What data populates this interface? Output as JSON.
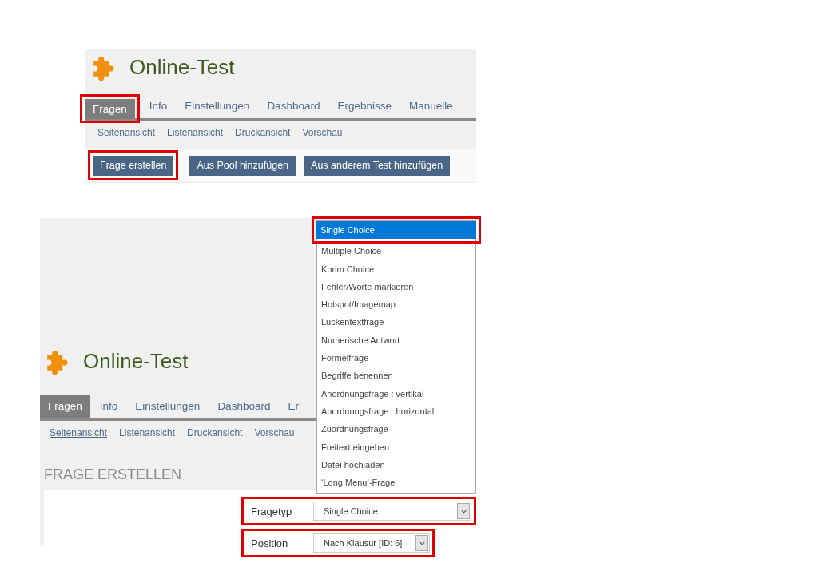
{
  "panels": [
    {
      "title": "Online-Test",
      "tabs": [
        {
          "label": "Fragen",
          "selected": true,
          "highlighted": true
        },
        {
          "label": "Info",
          "selected": false,
          "highlighted": false
        },
        {
          "label": "Einstellungen",
          "selected": false,
          "highlighted": false
        },
        {
          "label": "Dashboard",
          "selected": false,
          "highlighted": false
        },
        {
          "label": "Ergebnisse",
          "selected": false,
          "highlighted": false
        },
        {
          "label": "Manuelle",
          "selected": false,
          "highlighted": false
        }
      ],
      "subtabs": [
        {
          "label": "Seitenansicht",
          "selected": true
        },
        {
          "label": "Listenansicht",
          "selected": false
        },
        {
          "label": "Druckansicht",
          "selected": false
        },
        {
          "label": "Vorschau",
          "selected": false
        }
      ],
      "toolbar": [
        {
          "label": "Frage erstellen",
          "highlighted": true
        },
        {
          "label": "Aus Pool hinzufügen",
          "highlighted": false
        },
        {
          "label": "Aus anderem Test hinzufügen",
          "highlighted": false
        }
      ]
    },
    {
      "title": "Online-Test",
      "tabs": [
        {
          "label": "Fragen",
          "selected": true,
          "highlighted": false
        },
        {
          "label": "Info",
          "selected": false,
          "highlighted": false
        },
        {
          "label": "Einstellungen",
          "selected": false,
          "highlighted": false
        },
        {
          "label": "Dashboard",
          "selected": false,
          "highlighted": false
        },
        {
          "label": "Er",
          "selected": false,
          "highlighted": false
        }
      ],
      "subtabs": [
        {
          "label": "Seitenansicht",
          "selected": true
        },
        {
          "label": "Listenansicht",
          "selected": false
        },
        {
          "label": "Druckansicht",
          "selected": false
        },
        {
          "label": "Vorschau",
          "selected": false
        }
      ],
      "heading": "FRAGE ERSTELLEN",
      "fields": [
        {
          "label": "Fragetyp",
          "value": "Single Choice",
          "highlighted": true
        },
        {
          "label": "Position",
          "value": "Nach Klausur [ID: 6]",
          "highlighted": true
        }
      ],
      "dropdown": [
        {
          "label": "Single Choice",
          "selected": true,
          "highlighted": true
        },
        {
          "label": "Multiple Choice",
          "selected": false,
          "highlighted": false
        },
        {
          "label": "Kprim Choice",
          "selected": false,
          "highlighted": false
        },
        {
          "label": "Fehler/Worte markieren",
          "selected": false,
          "highlighted": false
        },
        {
          "label": "Hotspot/Imagemap",
          "selected": false,
          "highlighted": false
        },
        {
          "label": "Lückentextfrage",
          "selected": false,
          "highlighted": false
        },
        {
          "label": "Numerische Antwort",
          "selected": false,
          "highlighted": false
        },
        {
          "label": "Formelfrage",
          "selected": false,
          "highlighted": false
        },
        {
          "label": "Begriffe benennen",
          "selected": false,
          "highlighted": false
        },
        {
          "label": "Anordnungsfrage : vertikal",
          "selected": false,
          "highlighted": false
        },
        {
          "label": "Anordnungsfrage : horizontal",
          "selected": false,
          "highlighted": false
        },
        {
          "label": "Zuordnungsfrage",
          "selected": false,
          "highlighted": false
        },
        {
          "label": "Freitext eingeben",
          "selected": false,
          "highlighted": false
        },
        {
          "label": "Datei hochladen",
          "selected": false,
          "highlighted": false
        },
        {
          "label": "‘Long Menu’-Frage",
          "selected": false,
          "highlighted": false
        }
      ]
    }
  ]
}
